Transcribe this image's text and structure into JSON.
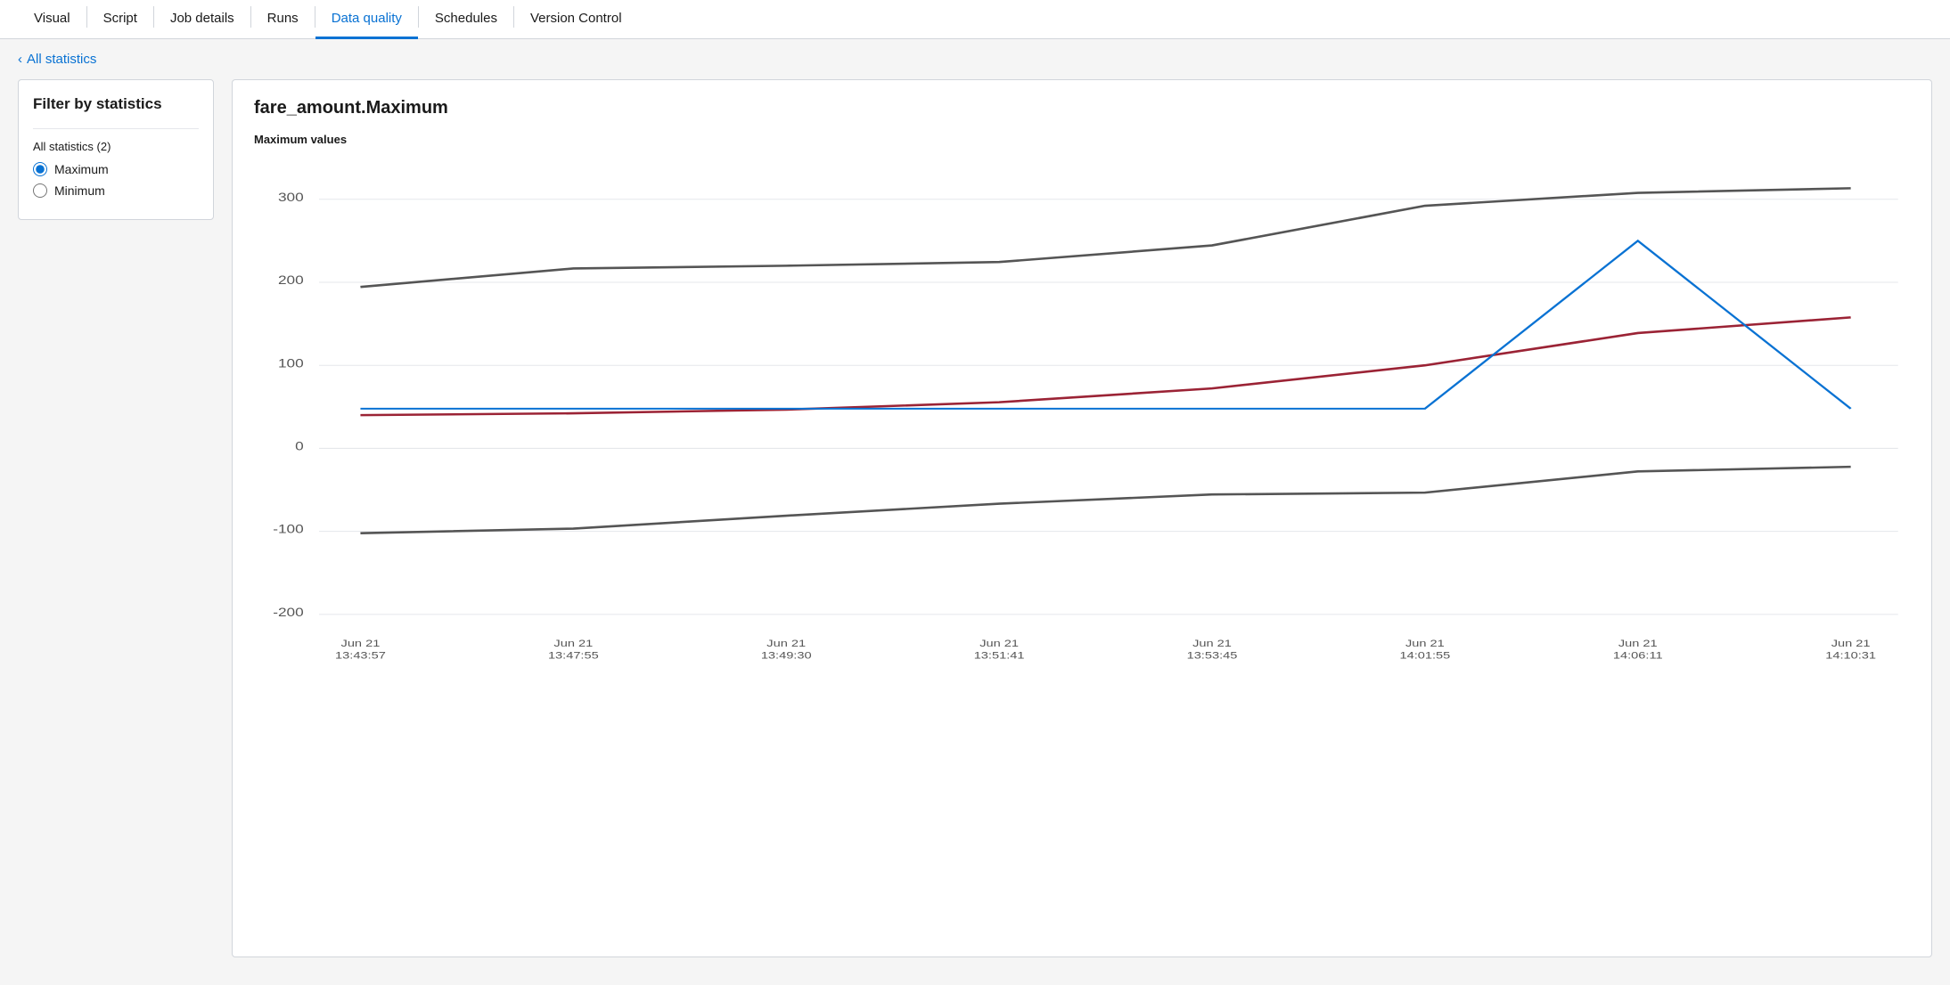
{
  "tabs": [
    {
      "id": "visual",
      "label": "Visual",
      "active": false
    },
    {
      "id": "script",
      "label": "Script",
      "active": false
    },
    {
      "id": "job-details",
      "label": "Job details",
      "active": false
    },
    {
      "id": "runs",
      "label": "Runs",
      "active": false
    },
    {
      "id": "data-quality",
      "label": "Data quality",
      "active": true
    },
    {
      "id": "schedules",
      "label": "Schedules",
      "active": false
    },
    {
      "id": "version-control",
      "label": "Version Control",
      "active": false
    }
  ],
  "breadcrumb": {
    "icon": "‹",
    "label": "All statistics"
  },
  "sidebar": {
    "filter_title": "Filter by statistics",
    "group_label": "All statistics (2)",
    "options": [
      {
        "id": "maximum",
        "label": "Maximum",
        "checked": true
      },
      {
        "id": "minimum",
        "label": "Minimum",
        "checked": false
      }
    ]
  },
  "chart": {
    "title": "fare_amount.Maximum",
    "subtitle": "Maximum values",
    "y_axis_labels": [
      "300",
      "200",
      "100",
      "0",
      "-100",
      "-200"
    ],
    "x_axis_labels": [
      "Jun 21\n13:43:57",
      "Jun 21\n13:47:55",
      "Jun 21\n13:49:30",
      "Jun 21\n13:51:41",
      "Jun 21\n13:53:45",
      "Jun 21\n14:01:55",
      "Jun 21\n14:06:11",
      "Jun 21\n14:10:31"
    ]
  }
}
